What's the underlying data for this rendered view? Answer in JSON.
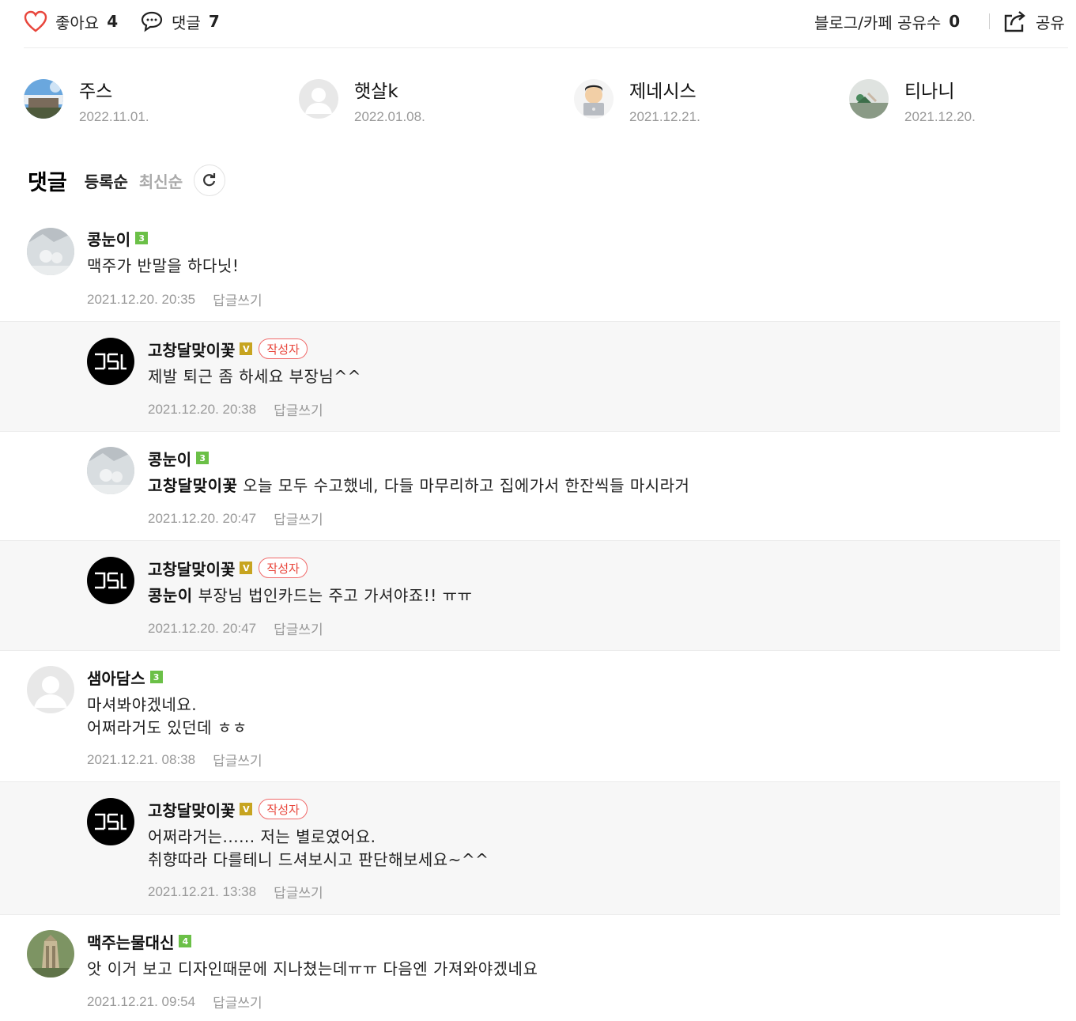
{
  "toolbar": {
    "like_label": "좋아요",
    "like_count": "4",
    "comment_label": "댓글",
    "comment_count": "7",
    "share_count_label": "블로그/카페 공유수",
    "share_count": "0",
    "share_label": "공유"
  },
  "likers": [
    {
      "name": "주스",
      "date": "2022.11.01.",
      "avatar": "photo-building-sky"
    },
    {
      "name": "햇살k",
      "date": "2022.01.08.",
      "avatar": "default-profile-icon"
    },
    {
      "name": "제네시스",
      "date": "2021.12.21.",
      "avatar": "character-laptop"
    },
    {
      "name": "티나니",
      "date": "2021.12.20.",
      "avatar": "photo-person-outdoor"
    }
  ],
  "comments_header": {
    "title": "댓글",
    "sort_registered": "등록순",
    "sort_latest": "최신순"
  },
  "reply_label": "답글쓰기",
  "author_tag": "작성자",
  "comments": [
    {
      "name": "콩눈이",
      "level": "3",
      "lines": [
        "맥주가 반말을 하다닛!"
      ],
      "date": "2021.12.20. 20:35"
    },
    {
      "name": "고창달맞이꽃",
      "level": "V",
      "lines": [
        "제발 퇴근 좀 하세요 부장님^^"
      ],
      "date": "2021.12.20. 20:38"
    },
    {
      "name": "콩눈이",
      "level": "3",
      "mention": "고창달맞이꽃",
      "lines": [
        "오늘 모두 수고했네, 다들 마무리하고 집에가서 한잔씩들 마시라거"
      ],
      "date": "2021.12.20. 20:47"
    },
    {
      "name": "고창달맞이꽃",
      "level": "V",
      "mention": "콩눈이",
      "lines": [
        "부장님 법인카드는 주고 가셔야죠!! ㅠㅠ"
      ],
      "date": "2021.12.20. 20:47"
    },
    {
      "name": "샘아담스",
      "level": "3",
      "lines": [
        "마셔봐야겠네요.",
        "어쩌라거도 있던데 ㅎㅎ"
      ],
      "date": "2021.12.21. 08:38"
    },
    {
      "name": "고창달맞이꽃",
      "level": "V",
      "lines": [
        "어쩌라거는...... 저는 별로였어요.",
        "취향따라 다를테니 드셔보시고 판단해보세요~^^"
      ],
      "date": "2021.12.21. 13:38"
    },
    {
      "name": "맥주는물대신",
      "level": "4",
      "lines": [
        "앗 이거 보고 디자인때문에 지나쳤는데ㅠㅠ 다음엔 가져와야겠네요"
      ],
      "date": "2021.12.21. 09:54"
    }
  ],
  "colors": {
    "like_heart": "#e8463c",
    "author_tag": "#e8463c",
    "level_green": "#6bc047",
    "level_gold": "#c7a420",
    "reply_bg": "#f7f7f7"
  }
}
